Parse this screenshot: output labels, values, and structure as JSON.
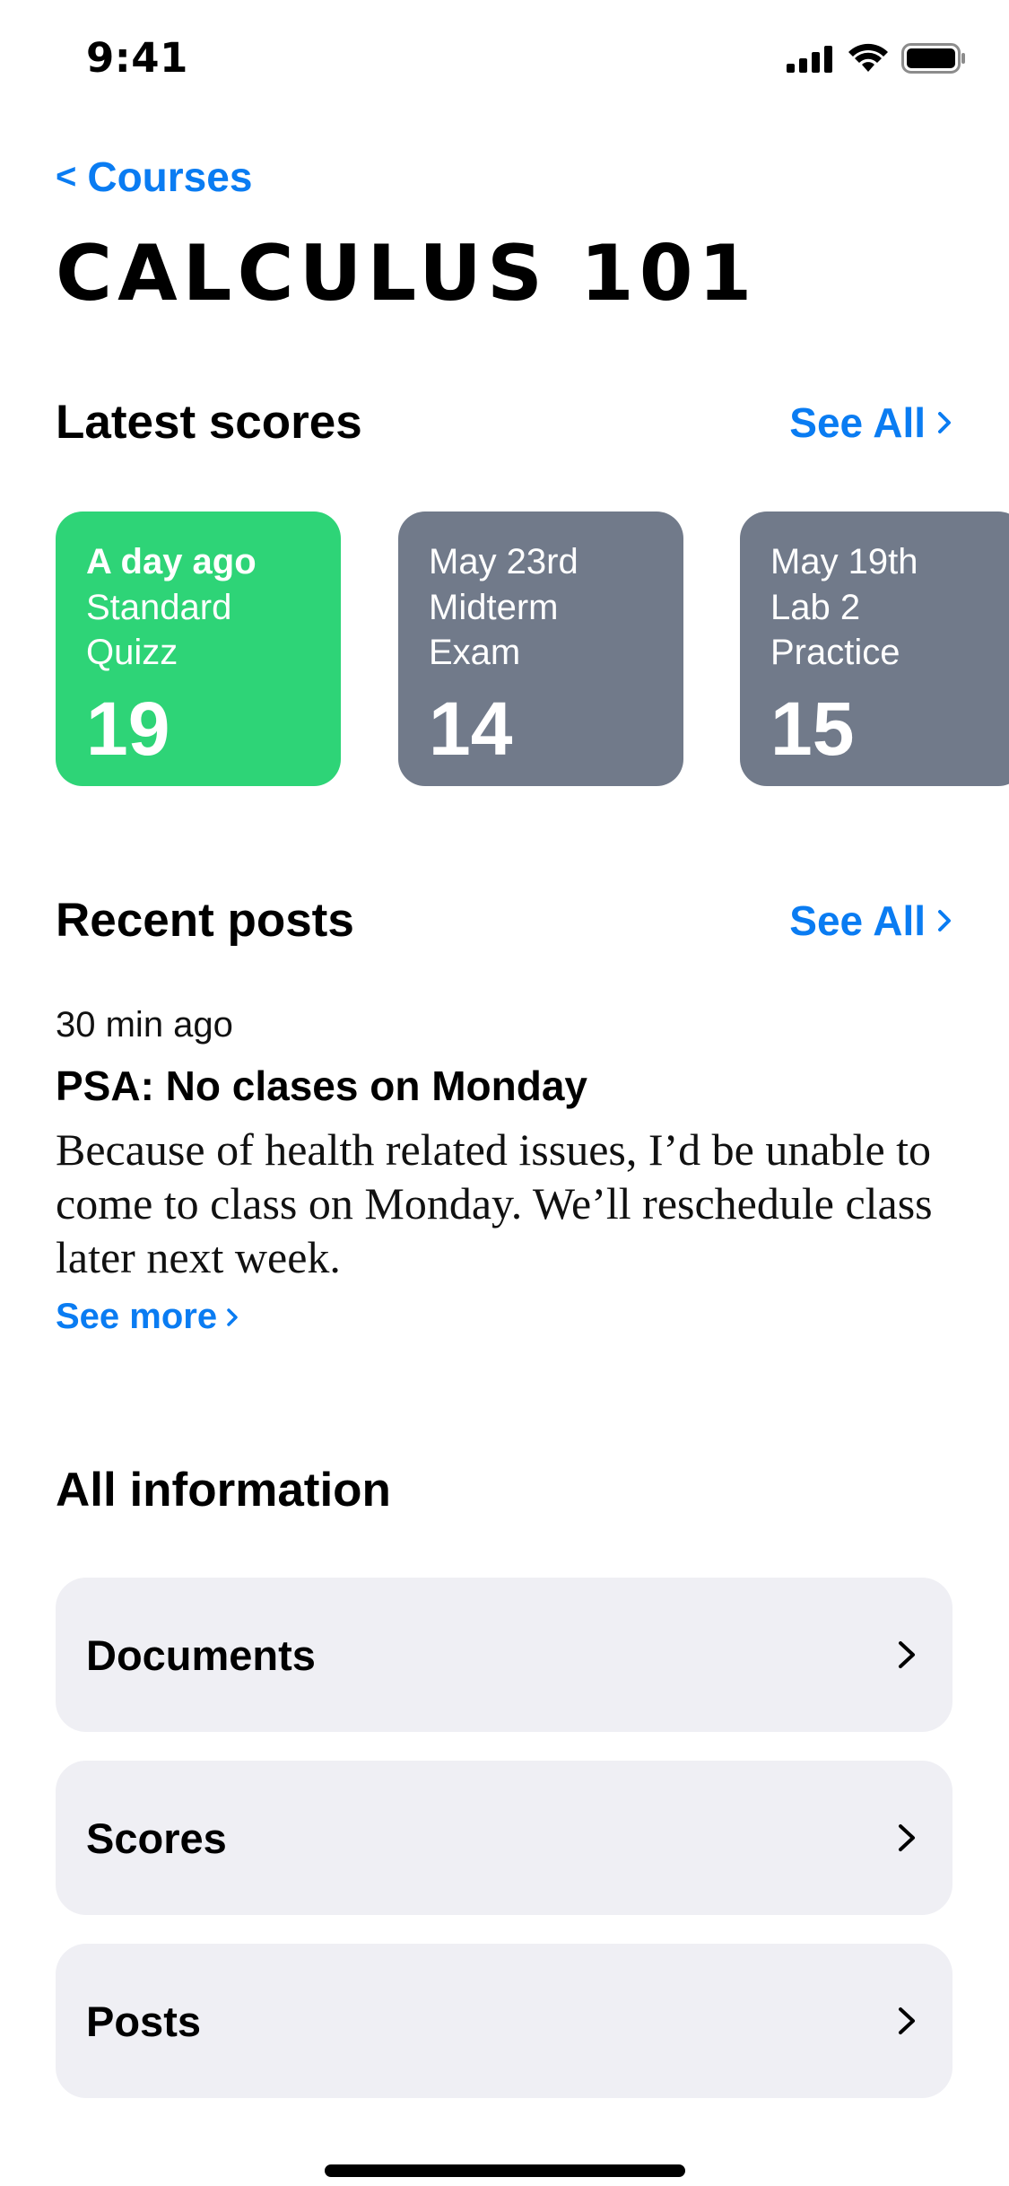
{
  "status_bar": {
    "time": "9:41",
    "icons": [
      "signal-icon",
      "wifi-icon",
      "battery-icon"
    ]
  },
  "header": {
    "back_label": "Courses",
    "back_chevron": "<",
    "title": "CALCULUS 101"
  },
  "latest_scores": {
    "title": "Latest scores",
    "see_all": "See All",
    "cards": [
      {
        "date": "A day ago",
        "name": "Standard Quizz",
        "score": "19",
        "color": "#2ed477"
      },
      {
        "date": "May 23rd",
        "name": "Midterm Exam",
        "score": "14",
        "color": "#717a8a"
      },
      {
        "date": "May 19th",
        "name": "Lab 2 Practice",
        "score": "15",
        "color": "#717a8a"
      }
    ]
  },
  "recent_posts": {
    "title": "Recent posts",
    "see_all": "See All",
    "post": {
      "time": "30 min ago",
      "title": "PSA: No clases on Monday",
      "body": "Because of health related issues, I’d be unable to come to class on Monday. We’ll reschedule class later next week.",
      "see_more": "See more"
    }
  },
  "all_information": {
    "title": "All information",
    "items": [
      {
        "label": "Documents"
      },
      {
        "label": "Scores"
      },
      {
        "label": "Posts"
      }
    ]
  },
  "colors": {
    "accent": "#0a7cf2",
    "card_green": "#2ed477",
    "card_gray": "#717a8a",
    "list_bg": "#efeff4"
  }
}
